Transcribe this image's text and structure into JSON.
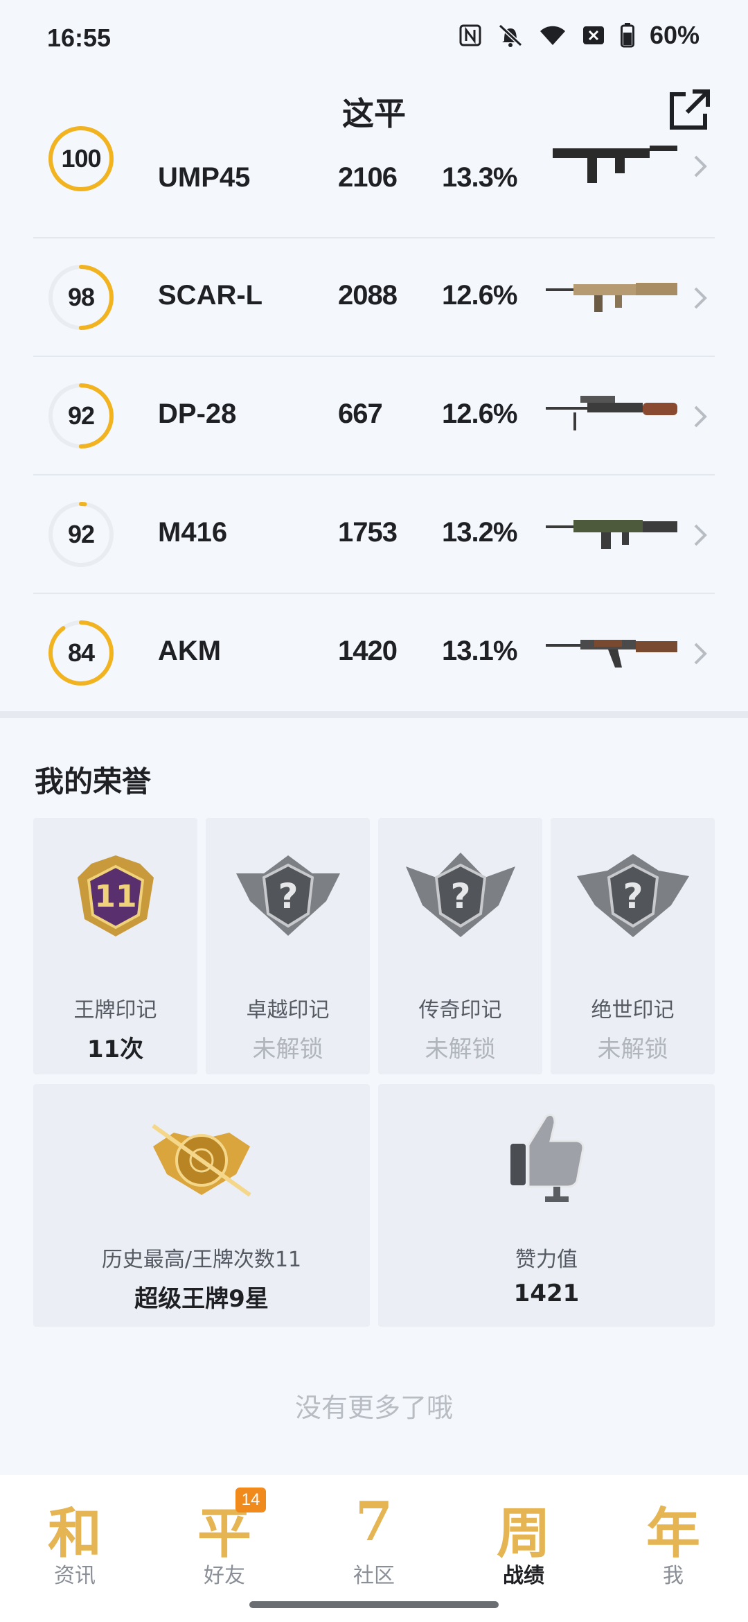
{
  "status_bar": {
    "time": "16:55",
    "battery": "60%",
    "icons": [
      "nfc-icon",
      "mute-icon",
      "wifi-icon",
      "sim-off-icon",
      "battery-icon"
    ]
  },
  "header": {
    "title": "这平",
    "share_icon": "share-external-icon"
  },
  "weapons": [
    {
      "score": "100",
      "progress": 1.0,
      "name": "UMP45",
      "kills": "2106",
      "rate": "13.3%"
    },
    {
      "score": "98",
      "progress": 0.5,
      "name": "SCAR-L",
      "kills": "2088",
      "rate": "12.6%"
    },
    {
      "score": "92",
      "progress": 0.5,
      "name": "DP-28",
      "kills": "667",
      "rate": "12.6%"
    },
    {
      "score": "92",
      "progress": 0.02,
      "name": "M416",
      "kills": "1753",
      "rate": "13.2%"
    },
    {
      "score": "84",
      "progress": 0.9,
      "name": "AKM",
      "kills": "1420",
      "rate": "13.1%"
    }
  ],
  "honors": {
    "title": "我的荣誉",
    "marks": [
      {
        "label": "王牌印记",
        "value": "11次",
        "badge_text": "11",
        "locked": false
      },
      {
        "label": "卓越印记",
        "value": "未解锁",
        "badge_text": "?",
        "locked": true
      },
      {
        "label": "传奇印记",
        "value": "未解锁",
        "badge_text": "?",
        "locked": true
      },
      {
        "label": "绝世印记",
        "value": "未解锁",
        "badge_text": "?",
        "locked": true
      }
    ],
    "highest": {
      "label": "历史最高/王牌次数11",
      "value": "超级王牌9星"
    },
    "likes": {
      "label": "赞力值",
      "value": "1421"
    }
  },
  "footer_text": "没有更多了哦",
  "nav": {
    "items": [
      {
        "glyph": "和",
        "label": "资讯",
        "active": false
      },
      {
        "glyph": "平",
        "label": "好友",
        "badge": "14",
        "active": false
      },
      {
        "glyph": "7",
        "label": "社区",
        "active": false
      },
      {
        "glyph": "周",
        "label": "战绩",
        "active": true
      },
      {
        "glyph": "年",
        "label": "我",
        "active": false
      }
    ]
  },
  "colors": {
    "accent": "#f2b320",
    "gauge_track": "#e9ecf1",
    "card_bg": "#ebeff5",
    "nav_gold": "#e5b553"
  }
}
